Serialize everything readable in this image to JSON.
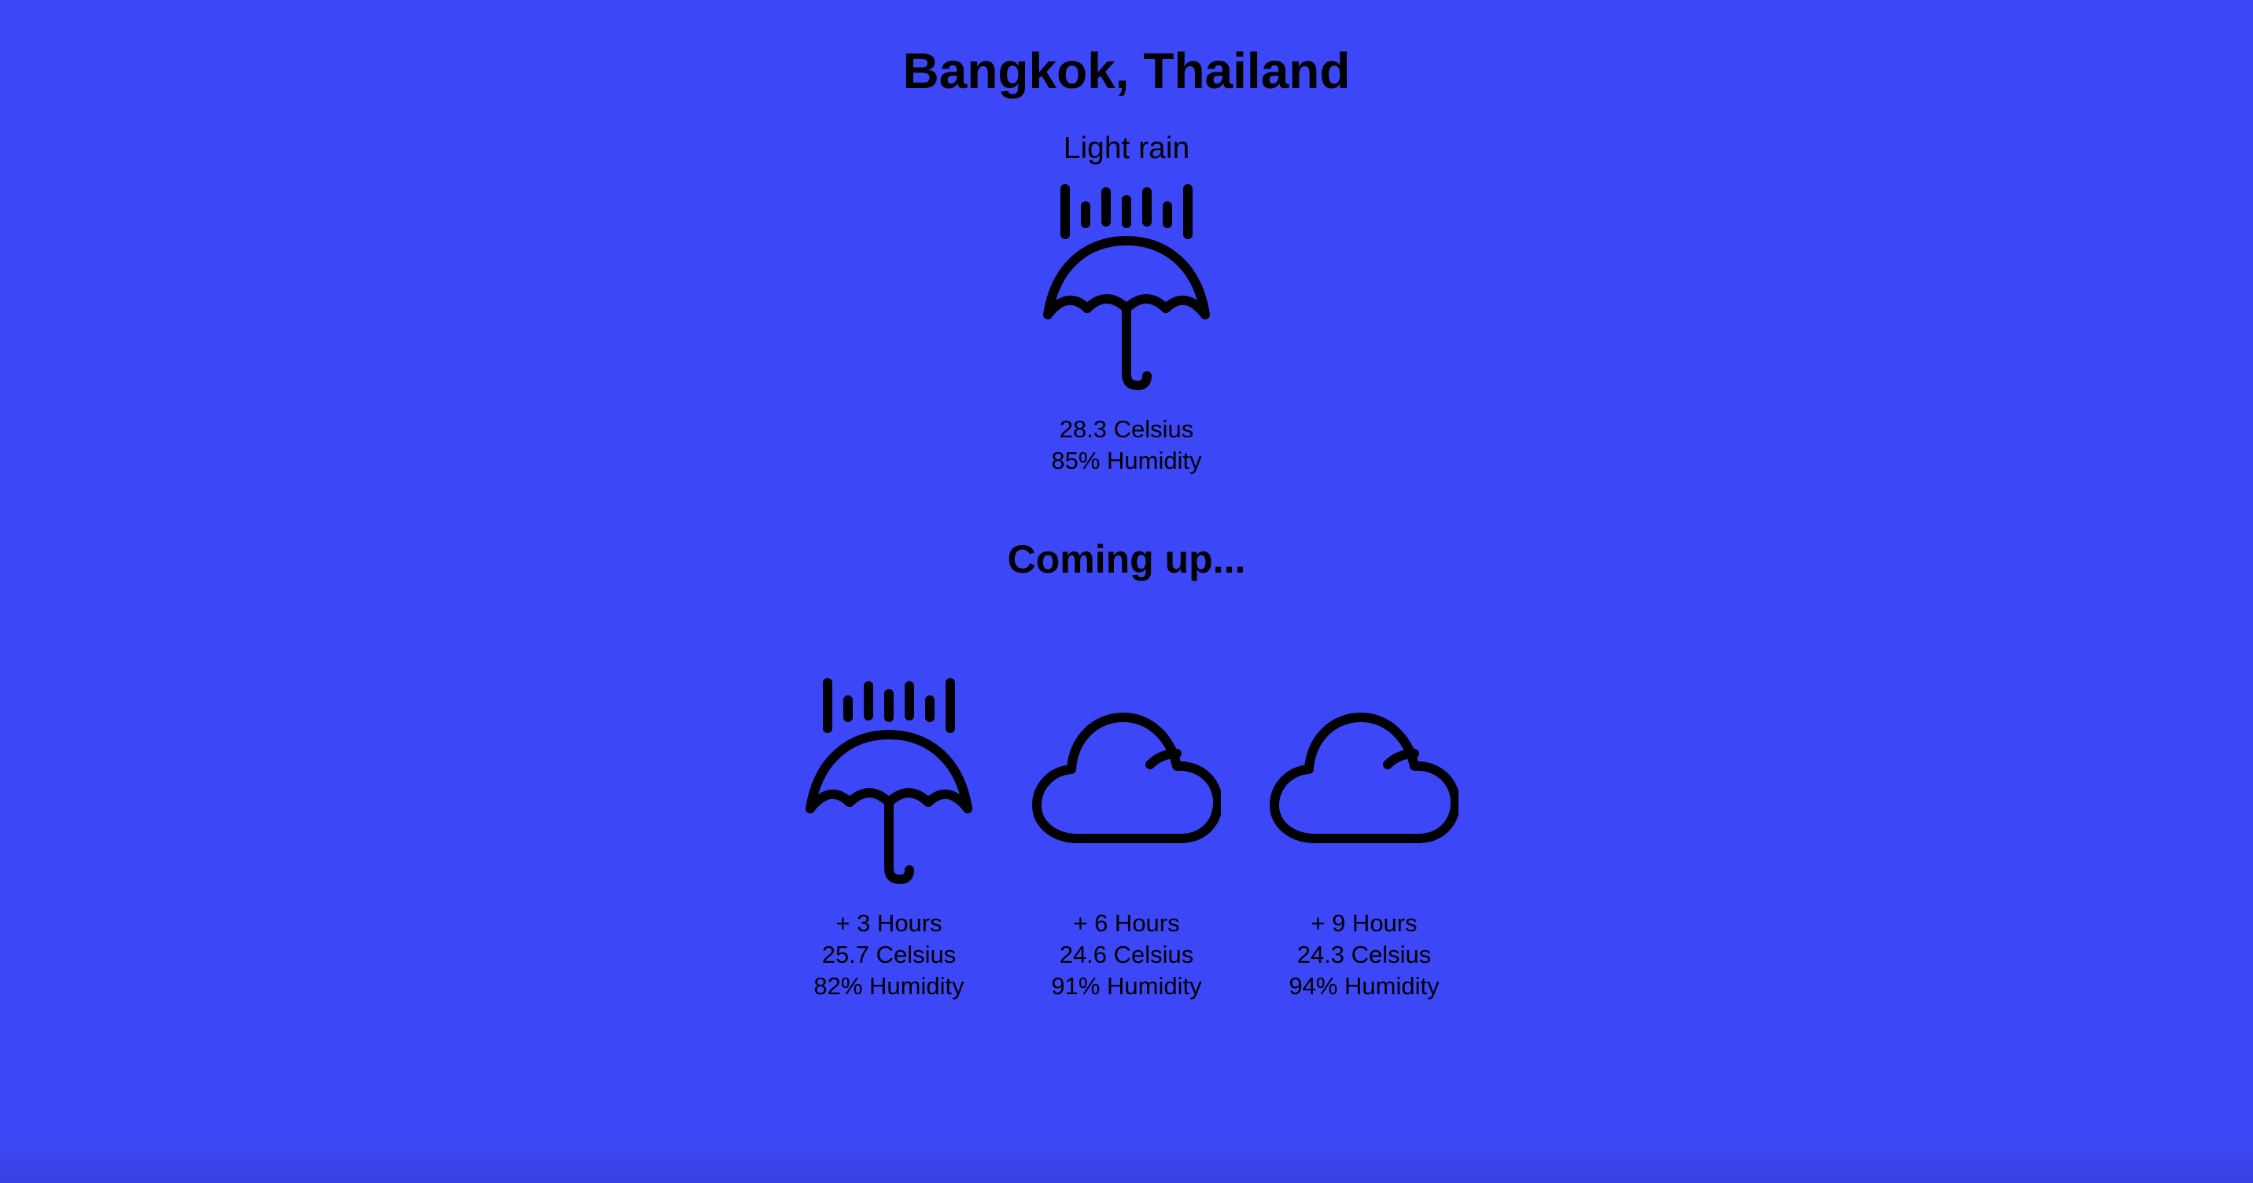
{
  "location": {
    "title": "Bangkok, Thailand"
  },
  "current": {
    "condition": "Light rain",
    "icon": "umbrella-rain-icon",
    "temperature": "28.3 Celsius",
    "humidity": "85% Humidity"
  },
  "forecast_heading": "Coming up...",
  "forecast": [
    {
      "offset": "+ 3 Hours",
      "temperature": "25.7 Celsius",
      "humidity": "82% Humidity",
      "icon": "umbrella-rain-icon"
    },
    {
      "offset": "+ 6 Hours",
      "temperature": "24.6 Celsius",
      "humidity": "91% Humidity",
      "icon": "cloud-icon"
    },
    {
      "offset": "+ 9 Hours",
      "temperature": "24.3 Celsius",
      "humidity": "94% Humidity",
      "icon": "cloud-icon"
    }
  ],
  "colors": {
    "background": "#3c48f7",
    "text": "#000000"
  }
}
